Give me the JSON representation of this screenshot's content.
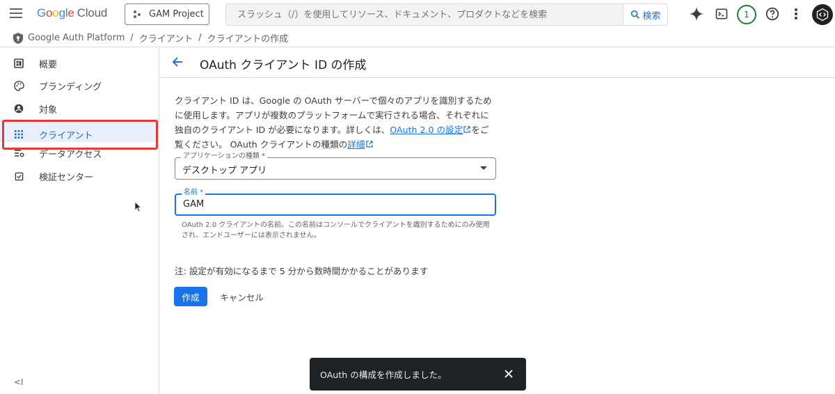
{
  "header": {
    "logo_letters": [
      "G",
      "o",
      "o",
      "g",
      "l",
      "e"
    ],
    "logo_suffix": "Cloud",
    "project_label": "GAM Project",
    "search_placeholder": "スラッシュ（/）を使用してリソース、ドキュメント、プロダクトなどを検索",
    "search_button": "検索",
    "notification_count": "1",
    "icons": [
      "menu-icon",
      "gemini-spark-icon",
      "cloud-shell-icon",
      "help-icon",
      "more-vert-icon",
      "avatar-code-icon"
    ]
  },
  "breadcrumb": {
    "items": [
      "Google Auth Platform",
      "クライアント",
      "クライアントの作成"
    ],
    "separator": "/"
  },
  "sidebar": {
    "items": [
      {
        "label": "概要",
        "icon": "dashboard-icon"
      },
      {
        "label": "ブランディング",
        "icon": "palette-icon"
      },
      {
        "label": "対象",
        "icon": "person-icon"
      },
      {
        "label": "クライアント",
        "icon": "grid-icon",
        "active": true
      },
      {
        "label": "データアクセス",
        "icon": "list-settings-icon"
      },
      {
        "label": "検証センター",
        "icon": "checkbox-icon"
      }
    ],
    "collapse_label": "<I"
  },
  "page": {
    "title": "OAuth クライアント ID の作成",
    "description_1": "クライアント ID は、Google の OAuth サーバーで個々のアプリを識別するために使用します。アプリが複数のプラットフォームで実行される場合、それぞれに独自のクライアント ID が必要になります。詳しくは、",
    "link_settings": "OAuth 2.0 の設定",
    "description_2": "をご覧ください。 OAuth クライアントの種類の",
    "link_details": "詳細",
    "app_type_label": "アプリケーションの種類 *",
    "app_type_value": "デスクトップ アプリ",
    "name_label": "名前 *",
    "name_value": "GAM",
    "name_hint": "OAuth 2.0 クライアントの名前。この名前はコンソールでクライアントを識別するためにのみ使用され、エンドユーザーには表示されません。",
    "note": "注: 設定が有効になるまで 5 分から数時間かかることがあります",
    "create_button": "作成",
    "cancel_button": "キャンセル"
  },
  "toast": {
    "message": "OAuth の構成を作成しました。"
  },
  "colors": {
    "primary": "#1a73e8",
    "active_bg": "#e8f0fe",
    "highlight_frame": "#e53935",
    "toast_bg": "#202124",
    "notif": "#188038"
  }
}
